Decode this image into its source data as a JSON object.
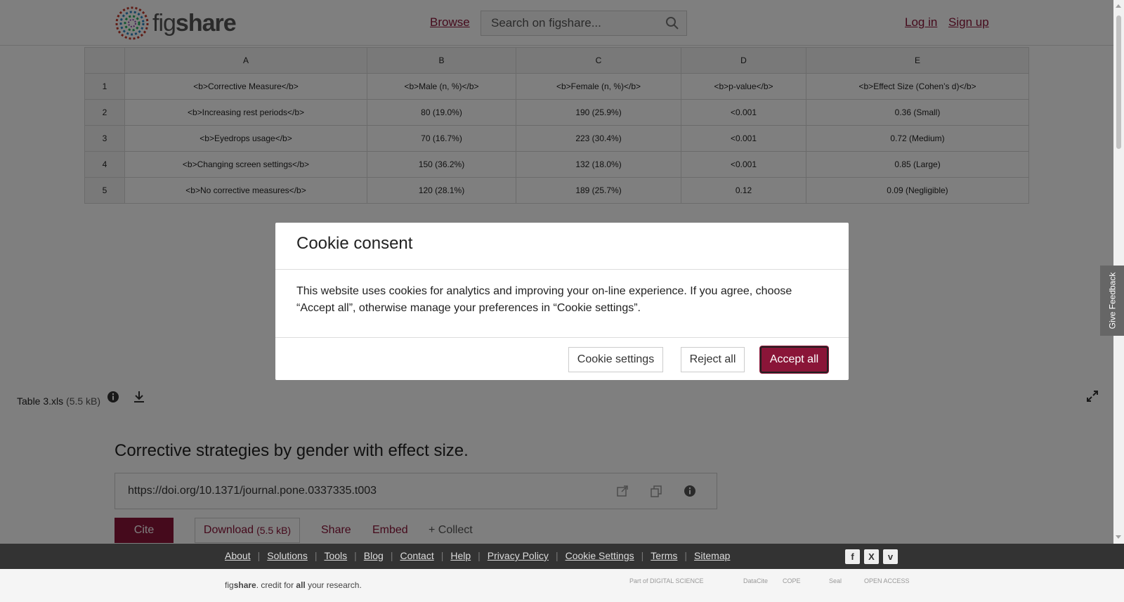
{
  "header": {
    "logo_fig": "fig",
    "logo_share": "share",
    "browse": "Browse",
    "search_placeholder": "Search on figshare...",
    "login": "Log in",
    "signup": "Sign up"
  },
  "sheet": {
    "columns": [
      "A",
      "B",
      "C",
      "D",
      "E"
    ],
    "rows": [
      {
        "num": "1",
        "cells": [
          "<b>Corrective Measure</b>",
          "<b>Male (n, %)</b>",
          "<b>Female (n, %)</b>",
          "<b>p-value</b>",
          "<b>Effect Size (Cohen’s d)</b>"
        ]
      },
      {
        "num": "2",
        "cells": [
          "<b>Increasing rest periods</b>",
          "80 (19.0%)",
          "190 (25.9%)",
          "<0.001",
          "0.36 (Small)"
        ]
      },
      {
        "num": "3",
        "cells": [
          "<b>Eyedrops usage</b>",
          "70 (16.7%)",
          "223 (30.4%)",
          "<0.001",
          "0.72 (Medium)"
        ]
      },
      {
        "num": "4",
        "cells": [
          "<b>Changing screen settings</b>",
          "150 (36.2%)",
          "132 (18.0%)",
          "<0.001",
          "0.85 (Large)"
        ]
      },
      {
        "num": "5",
        "cells": [
          "<b>No corrective measures</b>",
          "120 (28.1%)",
          "189 (25.7%)",
          "0.12",
          "0.09 (Negligible)"
        ]
      }
    ]
  },
  "file": {
    "name": "Table 3.xls",
    "size": "(5.5 kB)"
  },
  "item": {
    "title": "Corrective strategies by gender with effect size.",
    "doi": "https://doi.org/10.1371/journal.pone.0337335.t003",
    "cite": "Cite",
    "download": "Download",
    "download_size": "(5.5 kB)",
    "share": "Share",
    "embed": "Embed",
    "collect": "+ Collect"
  },
  "footer": {
    "links": [
      "About",
      "Solutions",
      "Tools",
      "Blog",
      "Contact",
      "Help",
      "Privacy Policy",
      "Cookie Settings",
      "Terms",
      "Sitemap"
    ],
    "credit_fig": "fig",
    "credit_share": "share",
    "credit_mid": ". credit for ",
    "credit_all": "all",
    "credit_end": " your research.",
    "partners": [
      "Part of DIGITAL SCIENCE",
      "DataCite",
      "COPE",
      "Seal",
      "OPEN ACCESS"
    ]
  },
  "feedback": "Give Feedback",
  "modal": {
    "title": "Cookie consent",
    "body": "This website uses cookies for analytics and improving your on-line experience. If you agree, choose “Accept all”, otherwise manage your preferences in “Cookie settings”.",
    "settings": "Cookie settings",
    "reject": "Reject all",
    "accept": "Accept all"
  },
  "colors": {
    "brand": "#8a1538",
    "overlay": "rgba(0,0,0,0.5)"
  }
}
